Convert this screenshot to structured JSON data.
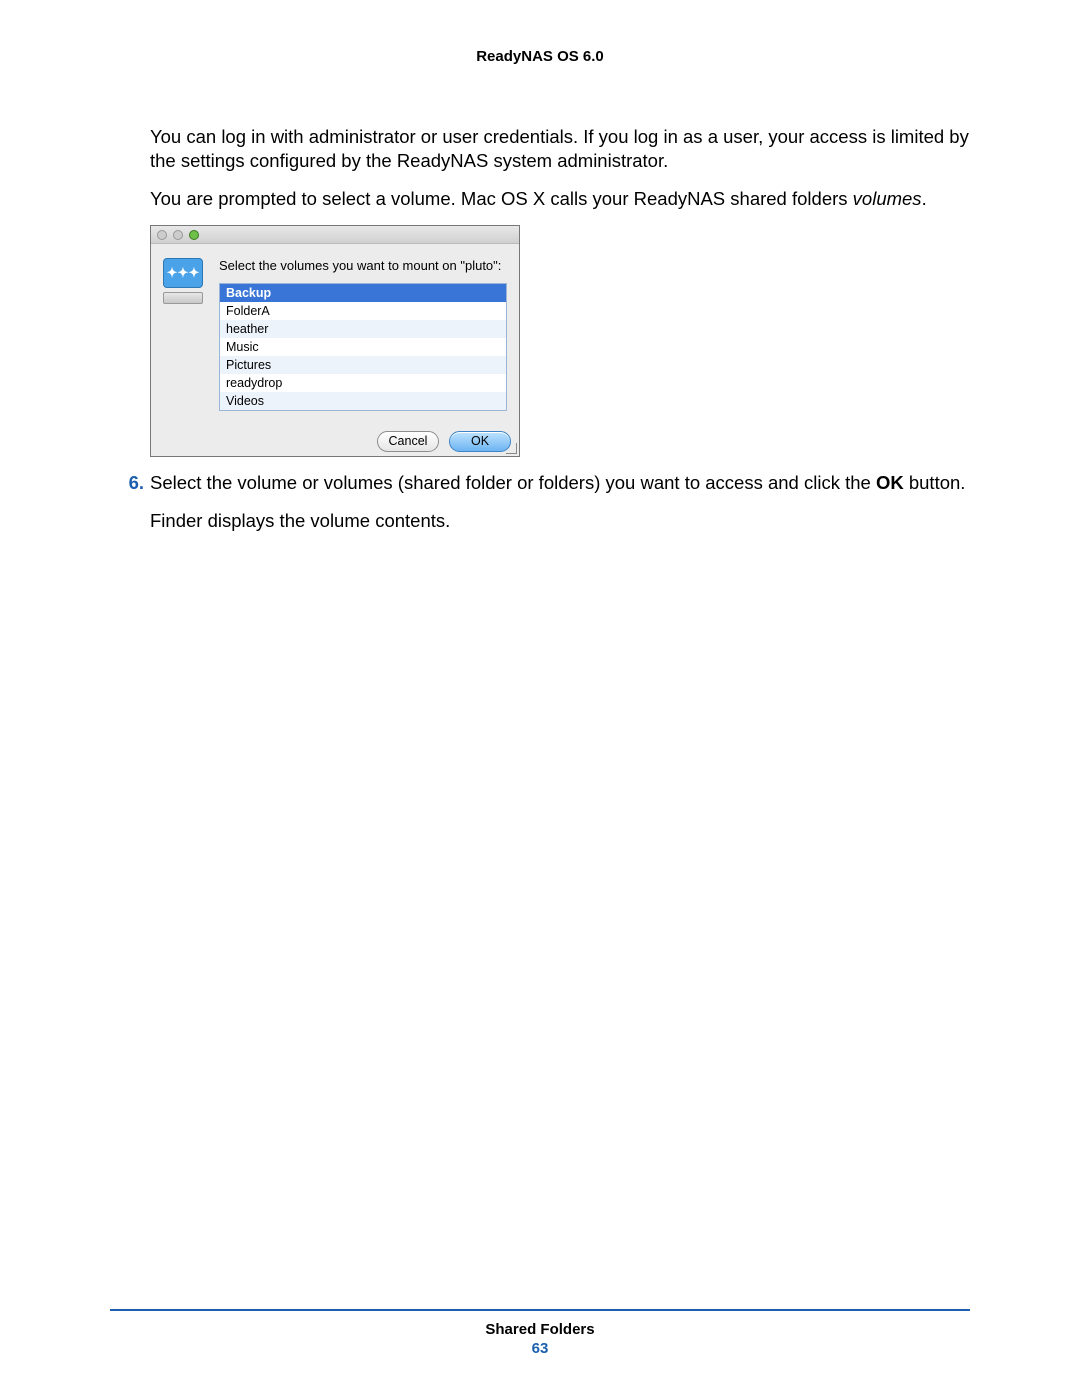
{
  "header": {
    "title": "ReadyNAS OS 6.0"
  },
  "paragraphs": {
    "p1": "You can log in with administrator or user credentials. If you log in as a user, your access is limited by the settings configured by the ReadyNAS system administrator.",
    "p2_a": "You are prompted to select a volume. Mac OS X calls your ReadyNAS shared folders ",
    "p2_b": "volumes",
    "p2_c": ".",
    "p3": "Finder displays the volume contents."
  },
  "step6": {
    "number": "6.",
    "text_a": "Select the volume or volumes (shared folder or folders) you want to access and click the ",
    "text_b": "OK",
    "text_c": " button."
  },
  "dialog": {
    "prompt": "Select the volumes you want to mount on \"pluto\":",
    "items": [
      "Backup",
      "FolderA",
      "heather",
      "Music",
      "Pictures",
      "readydrop",
      "Videos"
    ],
    "buttons": {
      "cancel": "Cancel",
      "ok": "OK"
    }
  },
  "footer": {
    "section": "Shared Folders",
    "page": "63"
  }
}
